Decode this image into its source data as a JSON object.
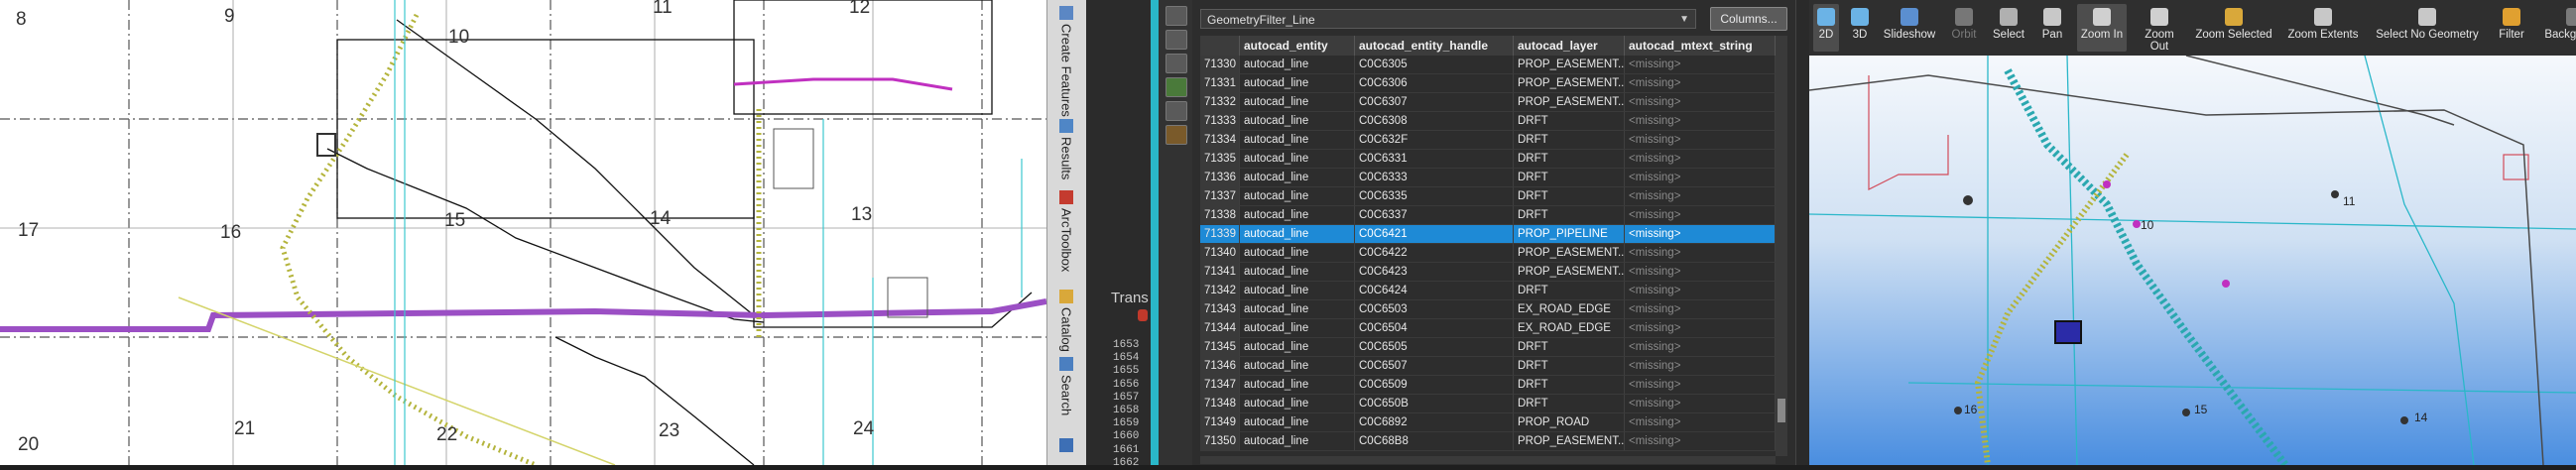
{
  "map_left": {
    "section_numbers": [
      "8",
      "9",
      "10",
      "11",
      "12",
      "17",
      "16",
      "15",
      "14",
      "13",
      "20",
      "21",
      "22",
      "23",
      "24"
    ]
  },
  "side_tabs": [
    "Create Features",
    "Results",
    "ArcToolbox",
    "Catalog",
    "Search"
  ],
  "transcript": {
    "label": "Trans",
    "lines": [
      "1653",
      "1654",
      "1655",
      "1656",
      "1657",
      "1658",
      "1659",
      "1660",
      "1661",
      "1662"
    ]
  },
  "table": {
    "filter_value": "GeometryFilter_Line",
    "columns_button": "Columns...",
    "headers": [
      "autocad_entity",
      "autocad_entity_handle",
      "autocad_layer",
      "autocad_mtext_string"
    ],
    "rows": [
      {
        "id": "71330",
        "entity": "autocad_line",
        "handle": "C0C6305",
        "layer": "PROP_EASEMENT...",
        "mtext": "<missing>"
      },
      {
        "id": "71331",
        "entity": "autocad_line",
        "handle": "C0C6306",
        "layer": "PROP_EASEMENT...",
        "mtext": "<missing>"
      },
      {
        "id": "71332",
        "entity": "autocad_line",
        "handle": "C0C6307",
        "layer": "PROP_EASEMENT...",
        "mtext": "<missing>"
      },
      {
        "id": "71333",
        "entity": "autocad_line",
        "handle": "C0C6308",
        "layer": "DRFT",
        "mtext": "<missing>"
      },
      {
        "id": "71334",
        "entity": "autocad_line",
        "handle": "C0C632F",
        "layer": "DRFT",
        "mtext": "<missing>"
      },
      {
        "id": "71335",
        "entity": "autocad_line",
        "handle": "C0C6331",
        "layer": "DRFT",
        "mtext": "<missing>"
      },
      {
        "id": "71336",
        "entity": "autocad_line",
        "handle": "C0C6333",
        "layer": "DRFT",
        "mtext": "<missing>"
      },
      {
        "id": "71337",
        "entity": "autocad_line",
        "handle": "C0C6335",
        "layer": "DRFT",
        "mtext": "<missing>"
      },
      {
        "id": "71338",
        "entity": "autocad_line",
        "handle": "C0C6337",
        "layer": "DRFT",
        "mtext": "<missing>"
      },
      {
        "id": "71339",
        "entity": "autocad_line",
        "handle": "C0C6421",
        "layer": "PROP_PIPELINE",
        "mtext": "<missing>",
        "selected": true
      },
      {
        "id": "71340",
        "entity": "autocad_line",
        "handle": "C0C6422",
        "layer": "PROP_EASEMENT...",
        "mtext": "<missing>"
      },
      {
        "id": "71341",
        "entity": "autocad_line",
        "handle": "C0C6423",
        "layer": "PROP_EASEMENT...",
        "mtext": "<missing>"
      },
      {
        "id": "71342",
        "entity": "autocad_line",
        "handle": "C0C6424",
        "layer": "DRFT",
        "mtext": "<missing>"
      },
      {
        "id": "71343",
        "entity": "autocad_line",
        "handle": "C0C6503",
        "layer": "EX_ROAD_EDGE",
        "mtext": "<missing>"
      },
      {
        "id": "71344",
        "entity": "autocad_line",
        "handle": "C0C6504",
        "layer": "EX_ROAD_EDGE",
        "mtext": "<missing>"
      },
      {
        "id": "71345",
        "entity": "autocad_line",
        "handle": "C0C6505",
        "layer": "DRFT",
        "mtext": "<missing>"
      },
      {
        "id": "71346",
        "entity": "autocad_line",
        "handle": "C0C6507",
        "layer": "DRFT",
        "mtext": "<missing>"
      },
      {
        "id": "71347",
        "entity": "autocad_line",
        "handle": "C0C6509",
        "layer": "DRFT",
        "mtext": "<missing>"
      },
      {
        "id": "71348",
        "entity": "autocad_line",
        "handle": "C0C650B",
        "layer": "DRFT",
        "mtext": "<missing>"
      },
      {
        "id": "71349",
        "entity": "autocad_line",
        "handle": "C0C6892",
        "layer": "PROP_ROAD",
        "mtext": "<missing>"
      },
      {
        "id": "71350",
        "entity": "autocad_line",
        "handle": "C0C68B8",
        "layer": "PROP_EASEMENT...",
        "mtext": "<missing>"
      }
    ]
  },
  "toolbar3d": {
    "items": [
      "2D",
      "3D",
      "Slideshow",
      "Orbit",
      "Select",
      "Pan",
      "Zoom In",
      "Zoom Out",
      "Zoom Selected",
      "Zoom Extents",
      "Select No Geometry",
      "Filter",
      "Background"
    ],
    "active": [
      "2D",
      "Zoom In"
    ],
    "disabled": [
      "Orbit"
    ]
  },
  "scene_labels": [
    "10",
    "11",
    "14",
    "15",
    "16"
  ],
  "colors": {
    "selection": "#1e8ad6",
    "accent_teal": "#2ab7c9",
    "pipeline": "#b4b43c",
    "route_purple": "#9b4fc4"
  }
}
